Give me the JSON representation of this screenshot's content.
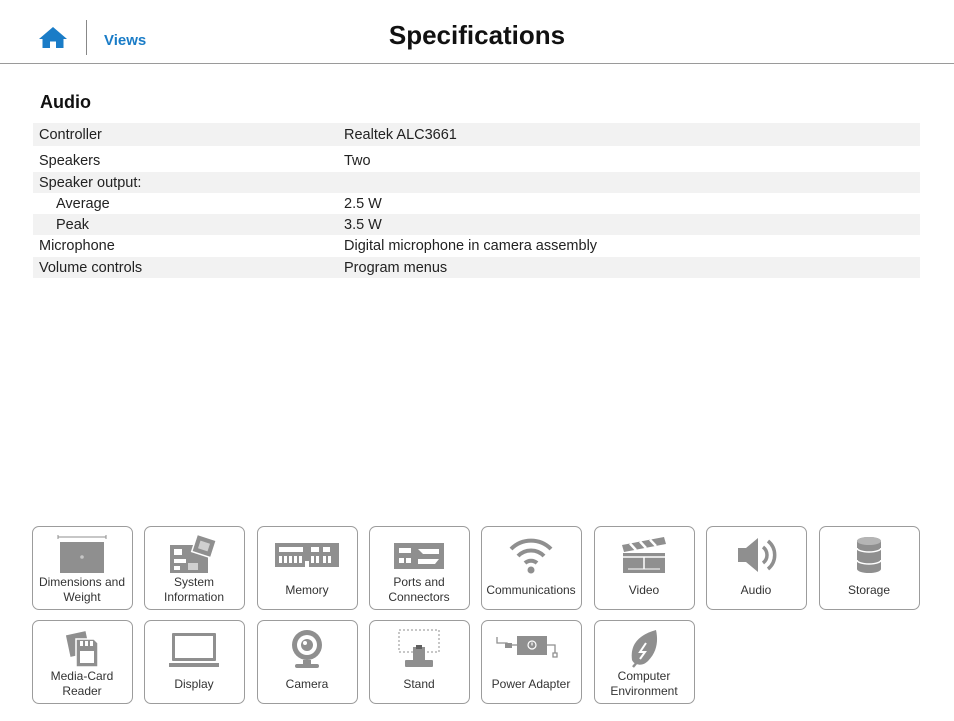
{
  "header": {
    "home_icon": "home-icon",
    "views_label": "Views",
    "title": "Specifications"
  },
  "section": {
    "title": "Audio"
  },
  "specs": [
    {
      "key": "Controller",
      "value": "Realtek ALC3661"
    },
    {
      "key": "Speakers",
      "value": "Two"
    },
    {
      "key": "Speaker output:",
      "value": ""
    },
    {
      "key": "Average",
      "value": "2.5 W"
    },
    {
      "key": "Peak",
      "value": "3.5 W"
    },
    {
      "key": "Microphone",
      "value": "Digital microphone in camera assembly"
    },
    {
      "key": "Volume controls",
      "value": "Program menus"
    }
  ],
  "tiles": [
    {
      "label": "Dimensions and\nWeight",
      "icon": "dimensions-icon"
    },
    {
      "label": "System\nInformation",
      "icon": "system-board-icon"
    },
    {
      "label": "Memory",
      "icon": "memory-icon"
    },
    {
      "label": "Ports and\nConnectors",
      "icon": "ports-icon"
    },
    {
      "label": "Communications",
      "icon": "wifi-icon"
    },
    {
      "label": "Video",
      "icon": "clapperboard-icon"
    },
    {
      "label": "Audio",
      "icon": "speaker-icon"
    },
    {
      "label": "Storage",
      "icon": "storage-icon"
    },
    {
      "label": "Media-Card\nReader",
      "icon": "media-card-icon"
    },
    {
      "label": "Display",
      "icon": "display-icon"
    },
    {
      "label": "Camera",
      "icon": "camera-icon"
    },
    {
      "label": "Stand",
      "icon": "stand-icon"
    },
    {
      "label": "Power Adapter",
      "icon": "power-adapter-icon"
    },
    {
      "label": "Computer\nEnvironment",
      "icon": "leaf-icon"
    }
  ],
  "colors": {
    "accent": "#1a7cc7",
    "icon_gray": "#8f8f8f",
    "row_shade": "#f2f2f2",
    "tile_border": "#9c9c9c"
  }
}
